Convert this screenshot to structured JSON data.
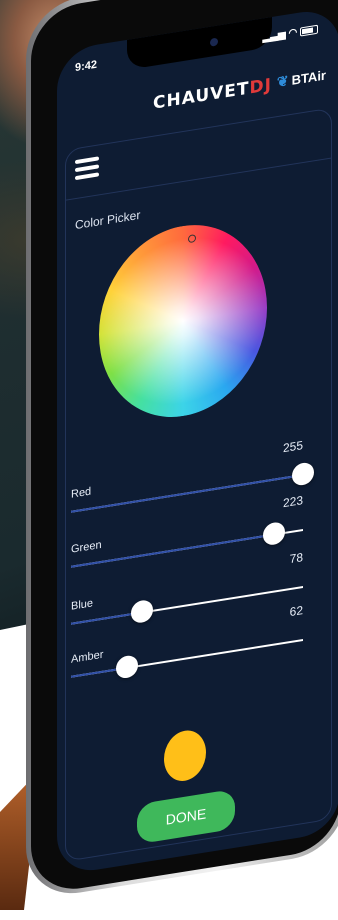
{
  "status_bar": {
    "time": "9:42"
  },
  "header": {
    "brand_main": "CHAUVET",
    "brand_accent": "DJ",
    "app_name": "BTAir"
  },
  "color_picker": {
    "title": "Color Picker"
  },
  "sliders": [
    {
      "label": "Red",
      "value": "255",
      "fraction": 1.0
    },
    {
      "label": "Green",
      "value": "223",
      "fraction": 0.875
    },
    {
      "label": "Blue",
      "value": "78",
      "fraction": 0.306
    },
    {
      "label": "Amber",
      "value": "62",
      "fraction": 0.243
    }
  ],
  "preview": {
    "color": "#ffbf18"
  },
  "actions": {
    "done_label": "DONE"
  },
  "colors": {
    "screen_bg": "#0e1c33",
    "done_button": "#3fb85b",
    "slider_fill": "#2f4fa8"
  }
}
